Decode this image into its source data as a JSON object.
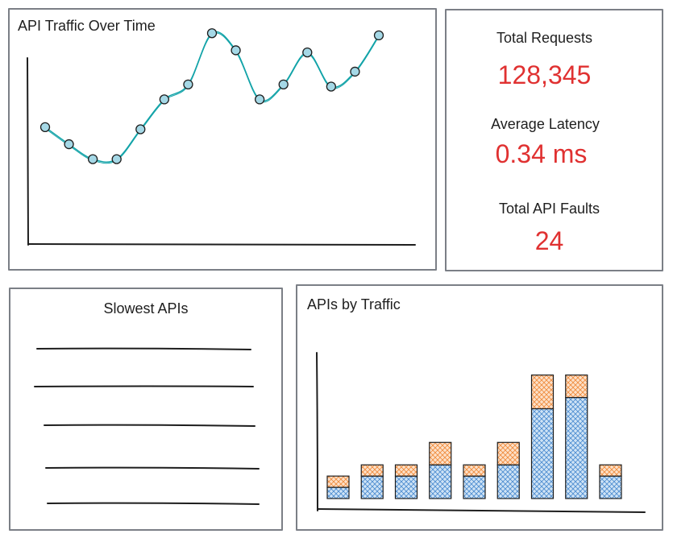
{
  "traffic_panel": {
    "title": "API Traffic Over Time"
  },
  "stats_panel": {
    "total_requests_label": "Total Requests",
    "total_requests_value": "128,345",
    "average_latency_label": "Average Latency",
    "average_latency_value": "0.34 ms",
    "total_faults_label": "Total API Faults",
    "total_faults_value": "24"
  },
  "slowest_panel": {
    "title": "Slowest APIs",
    "placeholder_rows": 5
  },
  "apis_panel": {
    "title": "APIs by Traffic"
  },
  "colors": {
    "value_red": "#e03131",
    "line_teal": "#12a3a8",
    "point_fill": "#a5d8e6",
    "bar_blue": "#6fa8dc",
    "bar_orange": "#f08c3c",
    "border_gray": "#7b7f86"
  },
  "chart_data": [
    {
      "type": "line",
      "title": "API Traffic Over Time",
      "xlabel": "",
      "ylabel": "",
      "x": [
        1,
        2,
        3,
        4,
        5,
        6,
        7,
        8,
        9,
        10,
        11,
        12,
        13,
        14
      ],
      "y": [
        0.51,
        0.43,
        0.36,
        0.36,
        0.5,
        0.64,
        0.71,
        0.95,
        0.87,
        0.64,
        0.71,
        0.86,
        0.7,
        0.77,
        0.94
      ],
      "ylim": [
        0,
        1
      ],
      "grid": false
    },
    {
      "type": "bar",
      "stacked": true,
      "title": "APIs by Traffic",
      "xlabel": "",
      "ylabel": "",
      "categories": [
        "",
        "",
        "",
        "",
        "",
        "",
        "",
        "",
        ""
      ],
      "series": [
        {
          "values": [
            0.085,
            0.17,
            0.17,
            0.255,
            0.17,
            0.255,
            0.68,
            0.765,
            0.17
          ]
        },
        {
          "values": [
            0.085,
            0.085,
            0.085,
            0.17,
            0.085,
            0.17,
            0.255,
            0.17,
            0.085
          ]
        }
      ],
      "ylim": [
        0,
        1
      ],
      "grid": false
    }
  ]
}
